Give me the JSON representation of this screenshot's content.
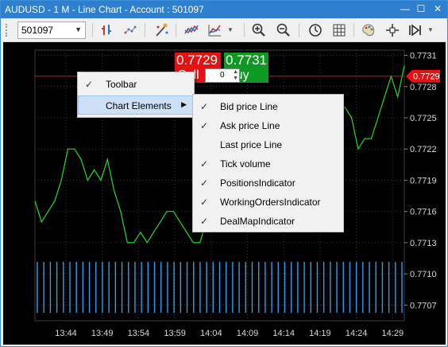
{
  "window": {
    "title": "AUDUSD - 1 M - Line Chart - Account : 501097",
    "min_glyph": "—",
    "max_glyph": "☐",
    "close_glyph": "✕"
  },
  "toolbar": {
    "account_value": "501097",
    "icons": [
      "bar-chart-icon",
      "scatter-chart-icon",
      "magic-wand-icon",
      "indicator-icon",
      "line-chart-icon",
      "zoom-in-icon",
      "zoom-out-icon",
      "clock-icon",
      "grid-icon",
      "palette-icon",
      "crosshair-icon",
      "autoscroll-icon"
    ]
  },
  "trade_panel": {
    "sell_price": "0.7729",
    "buy_price": "0.7731",
    "sell_label": "Sell",
    "buy_label": "Buy",
    "quantity": "0"
  },
  "current_price_tag": "0.7729",
  "colors": {
    "chart_line": "#22dd22",
    "volume": "#2a9ff0",
    "bid_line": "#e81010",
    "sell": "#e81010",
    "buy": "#0e9a22"
  },
  "context_menu": {
    "items": [
      {
        "label": "Toolbar",
        "checked": true
      },
      {
        "label": "Chart Elements",
        "checked": false,
        "submenu": true
      }
    ]
  },
  "submenu": {
    "items": [
      {
        "label": "Bid price Line",
        "checked": true
      },
      {
        "label": "Ask price Line",
        "checked": true
      },
      {
        "label": "Last price Line",
        "checked": false
      },
      {
        "label": "Tick volume",
        "checked": true
      },
      {
        "label": "PositionsIndicator",
        "checked": true
      },
      {
        "label": "WorkingOrdersIndicator",
        "checked": true
      },
      {
        "label": "DealMapIndicator",
        "checked": true
      }
    ]
  },
  "chart_data": {
    "type": "line",
    "title": "",
    "xlabel": "",
    "ylabel": "",
    "x_ticks": [
      "13:44",
      "13:49",
      "13:54",
      "13:59",
      "14:04",
      "14:09",
      "14:14",
      "14:19",
      "14:24",
      "14:29"
    ],
    "y_ticks": [
      "0.7731",
      "0.7728",
      "0.7725",
      "0.7722",
      "0.7719",
      "0.7716",
      "0.7713",
      "0.7710",
      "0.7707"
    ],
    "ylim": [
      0.77055,
      0.77315
    ],
    "grid": true,
    "series": [
      {
        "values": [
          0.7717,
          0.7715,
          0.7716,
          0.7717,
          0.7719,
          0.7722,
          0.7722,
          0.7721,
          0.7719,
          0.772,
          0.7719,
          0.7721,
          0.7718,
          0.7716,
          0.7713,
          0.7713,
          0.7714,
          0.7713,
          0.7714,
          0.7715,
          0.7716,
          0.7716,
          0.7715,
          0.7714,
          0.7713,
          0.7713,
          0.7715,
          0.7715,
          0.7716,
          0.7717,
          0.7718,
          0.7719,
          0.7719,
          0.772,
          0.7721,
          0.7722,
          0.7723,
          0.7724,
          0.7723,
          0.7723,
          0.7722,
          0.7723,
          0.7724,
          0.7722,
          0.7723,
          0.7724,
          0.7726,
          0.7726,
          0.7725,
          0.7722,
          0.7723,
          0.7723,
          0.7725,
          0.7727,
          0.7729,
          0.7727,
          0.773
        ]
      }
    ],
    "volume_bar_count": 57,
    "bid_price": 0.7729
  }
}
